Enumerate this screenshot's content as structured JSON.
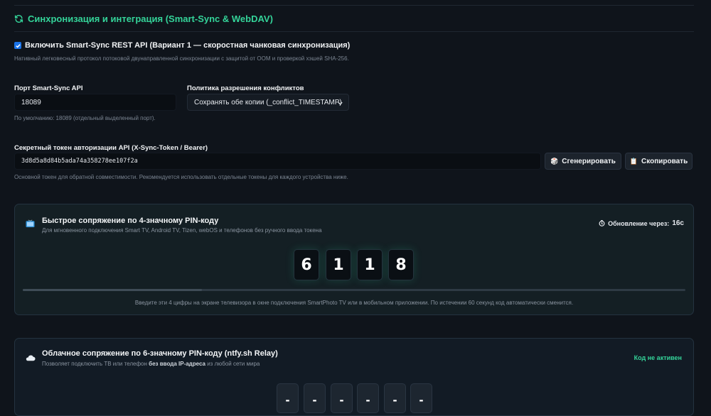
{
  "section": {
    "title": "Синхронизация и интеграция (Smart-Sync & WebDAV)",
    "icon": "sync-icon",
    "accent": "#34d399"
  },
  "enable_api": {
    "checked": true,
    "label": "Включить Smart-Sync REST API (Вариант 1 — скоростная чанковая синхронизация)",
    "hint": "Нативный легковесный протокол потоковой двунаправленной синхронизации с защитой от OOM и проверкой хэшей SHA-256."
  },
  "port": {
    "label": "Порт Smart-Sync API",
    "value": "18089",
    "hint": "По умолчанию: 18089 (отдельный выделенный порт)."
  },
  "conflict_policy": {
    "label": "Политика разрешения конфликтов",
    "selected": "Сохранять обе копии (_conflict_TIMESTAMP)"
  },
  "token": {
    "label": "Секретный токен авторизации API (X-Sync-Token / Bearer)",
    "value": "3d8d5a8d84b5ada74a358278ee107f2a",
    "generate_label": "Сгенерировать",
    "copy_label": "Скопировать",
    "hint": "Основной токен для обратной совместимости. Рекомендуется использовать отдельные токены для каждого устройства ниже."
  },
  "pin4": {
    "title": "Быстрое сопряжение по 4-значному PIN-коду",
    "subtitle": "Для мгновенного подключения Smart TV, Android TV, Tizen, webOS и телефонов без ручного ввода токена",
    "timer_label": "Обновление через:",
    "timer_value": "16с",
    "digits": [
      "6",
      "1",
      "1",
      "8"
    ],
    "progress": 0.27,
    "footer": "Введите эти 4 цифры на экране телевизора в окне подключения SmartPhoto TV или в мобильном приложении. По истечении 60 секунд код автоматически сменится."
  },
  "pin6": {
    "title": "Облачное сопряжение по 6-значному PIN-коду (ntfy.sh Relay)",
    "subtitle_pre": "Позволяет подключить ТВ или телефон ",
    "subtitle_bold": "без ввода IP-адреса",
    "subtitle_post": " из любой сети мира",
    "status": "Код не активен",
    "digits": [
      "-",
      "-",
      "-",
      "-",
      "-",
      "-"
    ]
  }
}
